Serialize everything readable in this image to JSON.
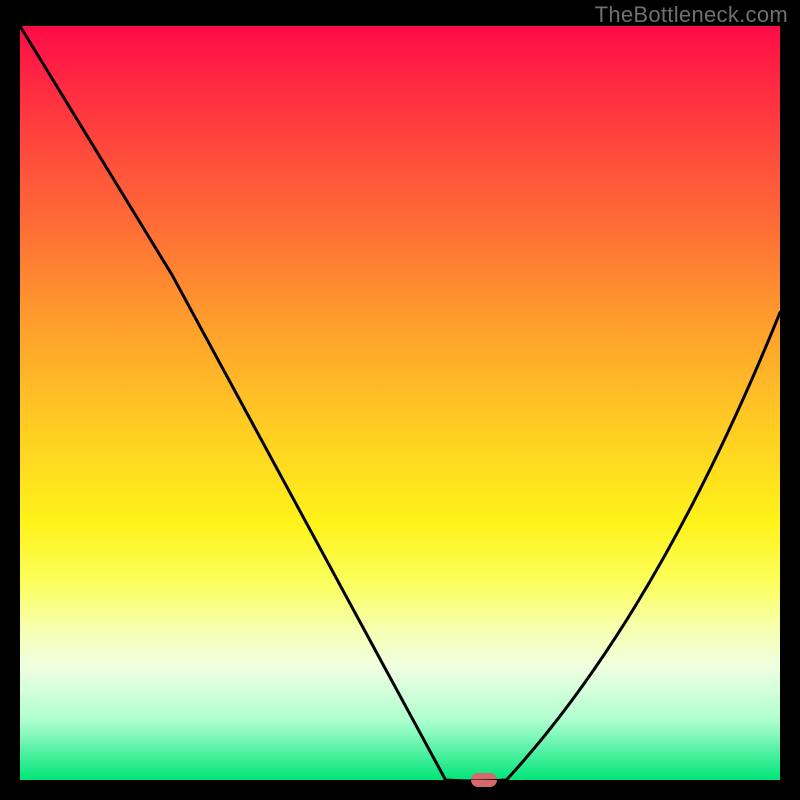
{
  "watermark": "TheBottleneck.com",
  "chart_data": {
    "type": "line",
    "title": "",
    "xlabel": "",
    "ylabel": "",
    "xlim": [
      0,
      100
    ],
    "ylim": [
      0,
      100
    ],
    "series": [
      {
        "name": "curve",
        "x": [
          0,
          20,
          56,
          60,
          64,
          100
        ],
        "y": [
          100,
          67,
          0,
          0,
          0,
          62
        ]
      }
    ],
    "marker": {
      "x": 61,
      "y": 0,
      "color": "#d4696e"
    },
    "gradient_stops": [
      {
        "pos": 0,
        "color": "#ff0b47"
      },
      {
        "pos": 12,
        "color": "#ff3a3f"
      },
      {
        "pos": 26,
        "color": "#ff6b36"
      },
      {
        "pos": 40,
        "color": "#ffa02c"
      },
      {
        "pos": 54,
        "color": "#ffcf22"
      },
      {
        "pos": 66,
        "color": "#fff31a"
      },
      {
        "pos": 74,
        "color": "#fbff5f"
      },
      {
        "pos": 80,
        "color": "#f7ffb0"
      },
      {
        "pos": 85,
        "color": "#f0ffe0"
      },
      {
        "pos": 92,
        "color": "#b0ffd0"
      },
      {
        "pos": 100,
        "color": "#00e57a"
      }
    ]
  }
}
